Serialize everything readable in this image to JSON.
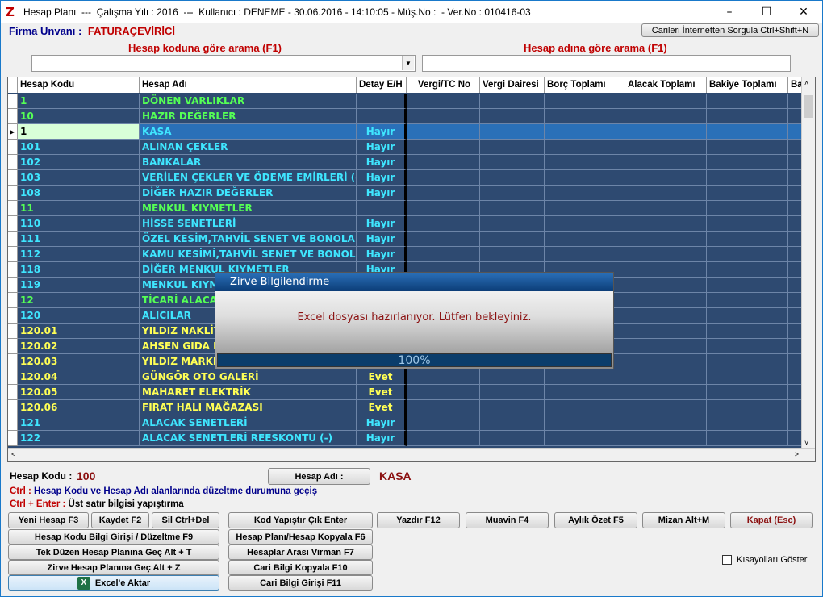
{
  "titlebar": {
    "logo": "Z",
    "title": "Hesap Planı  ---  Çalışma Yılı : 2016  ---  Kullanıcı : DENEME - 30.06.2016 - 14:10:05 - Müş.No :  - Ver.No : 010416-03",
    "minimize": "–",
    "maximize": "☐",
    "close": "✕"
  },
  "firma": {
    "label": "Firma Unvanı :",
    "value": "FATURAÇEVİRİCİ"
  },
  "sorgu_button": "Carileri İnternetten Sorgula Ctrl+Shift+N",
  "search": {
    "code_label": "Hesap koduna göre arama (F1)",
    "name_label": "Hesap adına göre arama (F1)",
    "code_value": "",
    "name_value": ""
  },
  "grid": {
    "columns": [
      "Hesap Kodu",
      "Hesap Adı",
      "Detay E/H",
      "Vergi/TC No",
      "Vergi Dairesi",
      "Borç Toplamı",
      "Alacak Toplamı",
      "Bakiye Toplamı",
      "Ba"
    ],
    "rows": [
      {
        "code": "1",
        "name": "DÖNEN VARLIKLAR",
        "detay": "",
        "color": "green"
      },
      {
        "code": "10",
        "name": "HAZIR DEĞERLER",
        "detay": "",
        "color": "green"
      },
      {
        "code": "1",
        "name": "KASA",
        "detay": "Hayır",
        "color": "cyan",
        "selected": true
      },
      {
        "code": "101",
        "name": "ALINAN ÇEKLER",
        "detay": "Hayır",
        "color": "cyan"
      },
      {
        "code": "102",
        "name": "BANKALAR",
        "detay": "Hayır",
        "color": "cyan"
      },
      {
        "code": "103",
        "name": "VERİLEN ÇEKLER VE ÖDEME EMİRLERİ (-)",
        "detay": "Hayır",
        "color": "cyan"
      },
      {
        "code": "108",
        "name": "DİĞER HAZIR DEĞERLER",
        "detay": "Hayır",
        "color": "cyan"
      },
      {
        "code": "11",
        "name": "MENKUL KIYMETLER",
        "detay": "",
        "color": "green"
      },
      {
        "code": "110",
        "name": "HİSSE SENETLERİ",
        "detay": "Hayır",
        "color": "cyan"
      },
      {
        "code": "111",
        "name": "ÖZEL KESİM,TAHVİL SENET VE BONOLARI",
        "detay": "Hayır",
        "color": "cyan"
      },
      {
        "code": "112",
        "name": "KAMU KESİMİ,TAHVİL SENET VE BONOLARI",
        "detay": "Hayır",
        "color": "cyan"
      },
      {
        "code": "118",
        "name": "DİĞER MENKUL KIYMETLER",
        "detay": "Hayır",
        "color": "cyan"
      },
      {
        "code": "119",
        "name": "MENKUL KIYME",
        "detay": "",
        "color": "cyan"
      },
      {
        "code": "12",
        "name": "TİCARİ ALACA",
        "detay": "",
        "color": "green"
      },
      {
        "code": "120",
        "name": "ALICILAR",
        "detay": "",
        "color": "cyan"
      },
      {
        "code": "120.01",
        "name": "YILDIZ NAKLİYA",
        "detay": "",
        "color": "yellow"
      },
      {
        "code": "120.02",
        "name": "AHSEN GIDA PA",
        "detay": "",
        "color": "yellow"
      },
      {
        "code": "120.03",
        "name": "YILDIZ MARKET",
        "detay": "",
        "color": "yellow"
      },
      {
        "code": "120.04",
        "name": "GÜNGÖR OTO GALERİ",
        "detay": "Evet",
        "color": "yellow"
      },
      {
        "code": "120.05",
        "name": "MAHARET ELEKTRİK",
        "detay": "Evet",
        "color": "yellow"
      },
      {
        "code": "120.06",
        "name": "FIRAT HALI MAĞAZASI",
        "detay": "Evet",
        "color": "yellow"
      },
      {
        "code": "121",
        "name": "ALACAK SENETLERİ",
        "detay": "Hayır",
        "color": "cyan"
      },
      {
        "code": "122",
        "name": "ALACAK SENETLERİ REESKONTU (-)",
        "detay": "Hayır",
        "color": "cyan"
      }
    ]
  },
  "dialog": {
    "title": "Zirve Bilgilendirme",
    "message": "Excel dosyası hazırlanıyor. Lütfen bekleyiniz.",
    "progress_text": "100%",
    "progress": 1.0
  },
  "info": {
    "hesap_kodu_label": "Hesap Kodu :",
    "hesap_kodu_value": "100",
    "hesap_adi_button": "Hesap Adı :",
    "hesap_adi_value": "KASA",
    "hint1_key": "Ctrl :",
    "hint1_text": "Hesap Kodu ve Hesap Adı alanlarında düzeltme durumuna geçiş",
    "hint2_key": "Ctrl + Enter :",
    "hint2_text": "Üst satır bilgisi yapıştırma"
  },
  "buttons": {
    "yeni_hesap": "Yeni Hesap F3",
    "kaydet": "Kaydet F2",
    "sil": "Sil Ctrl+Del",
    "kod_yapistir": "Kod Yapıştır Çık Enter",
    "yazdir": "Yazdır F12",
    "muavin": "Muavin F4",
    "aylik_ozet": "Aylık Özet F5",
    "mizan": "Mizan Alt+M",
    "kapat": "Kapat (Esc)",
    "hesap_kodu_bilgi": "Hesap Kodu Bilgi Girişi / Düzeltme F9",
    "hesap_plani_kopyala": "Hesap Planı/Hesap Kopyala F6",
    "tek_duzen": "Tek Düzen Hesap Planına Geç Alt + T",
    "virman": "Hesaplar Arası Virman F7",
    "zirve_hesap": "Zirve Hesap Planına Geç Alt + Z",
    "cari_kopyala": "Cari Bilgi Kopyala F10",
    "excel": "Excel'e Aktar",
    "cari_giris": "Cari Bilgi Girişi F11"
  },
  "checkbox": {
    "label": "Kısayolları Göster",
    "checked": false
  }
}
